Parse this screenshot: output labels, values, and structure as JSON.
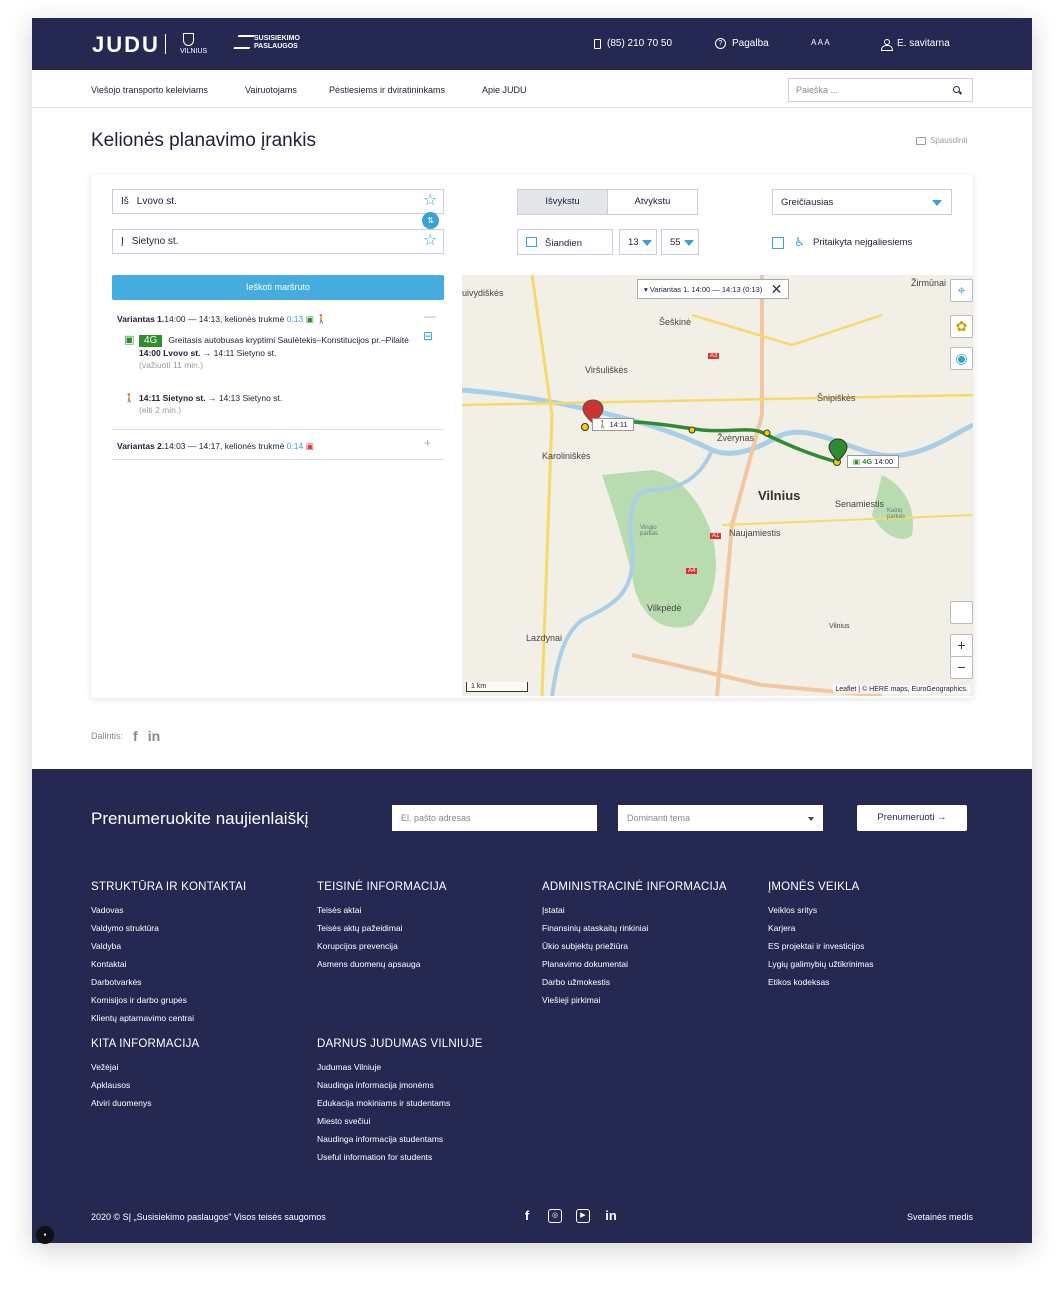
{
  "header": {
    "logo": "JUDU",
    "vilnius_label": "VILNIUS",
    "partner_logo": "SUSISIEKIMO PASLAUGOS",
    "phone": "(85) 210 70 50",
    "help": "Pagalba",
    "font_size": "A A A",
    "account": "E. savitarna"
  },
  "nav": {
    "items": [
      "Viešojo transporto keleiviams",
      "Vairuotojams",
      "Pėstiesiems ir dviratininkams",
      "Apie JUDU"
    ],
    "search_placeholder": "Paieška ..."
  },
  "page": {
    "title": "Kelionės planavimo įrankis",
    "print_label": "Spausdinti"
  },
  "planner": {
    "from_label": "Iš",
    "from_value": "Lvovo st.",
    "to_label": "Į",
    "to_value": "Sietyno st.",
    "depart_tab": "Išvykstu",
    "arrive_tab": "Atvykstu",
    "sort_option": "Greičiausias",
    "date_value": "Šiandien",
    "hour_value": "13",
    "minute_value": "55",
    "accessible_label": "Pritaikyta neįgaliesiems",
    "search_button": "Ieškoti maršruto"
  },
  "results": {
    "variant1": {
      "name": "Variantas 1.",
      "time": "14:00 — 14:13",
      "duration_label": "kelionės trukmė",
      "duration": "0:13",
      "toggle": "—",
      "route_badge": "4G",
      "route_desc": "Greitasis autobusas kryptimi Saulėtekis–Konstitucijos pr.–Pilaitė",
      "bus_leg": "14:00 Lvovo st.",
      "bus_leg_end": "→ 14:11 Sietyno st.",
      "bus_note": "(važiuoti 11 min.)",
      "walk_leg": "14:11 Sietyno st.",
      "walk_leg_end": "→ 14:13 Sietyno st.",
      "walk_note": "(eiti 2 min.)"
    },
    "variant2": {
      "name": "Variantas 2.",
      "time": "14:03 — 14:17",
      "duration_label": "kelionės trukmė",
      "duration": "0:14",
      "toggle": "+"
    }
  },
  "map": {
    "tooltip": "Variantas 1.  14:00 — 14:13 (0:13)",
    "walk_marker": "14:11",
    "bus_marker_route": "4G",
    "bus_marker_time": "14:00",
    "scale": "1 km",
    "attribution": "Leaflet | © HERE maps, EuroGeographics.",
    "zoom_in": "+",
    "zoom_out": "−",
    "labels": {
      "zirmunai": "Žirmūnai",
      "seskine": "Šeškinė",
      "virsuliskes": "Viršuliškės",
      "snipiskes": "Šnipiškės",
      "zverynas": "Žvėrynas",
      "karoliniskes": "Karoliniškės",
      "vilnius": "Vilnius",
      "senamiestis": "Senamiestis",
      "naujamiestis": "Naujamiestis",
      "vilkpede": "Vilkpėdė",
      "lazdynai": "Lazdynai",
      "juosvidiskes": "uivydiškės",
      "vingio": "Vingio parkas",
      "kalnu": "Kalnų parkas",
      "a3": "A3",
      "a1": "A1",
      "a4": "A4",
      "vilnius_station": "Vilnius"
    }
  },
  "share": {
    "label": "Dalintis:"
  },
  "footer": {
    "newsletter_title": "Prenumeruokite naujienlaiškį",
    "email_placeholder": "El. pašto adresas",
    "topic_placeholder": "Dominanti tema",
    "subscribe_button": "Prenumeruoti",
    "columns": [
      {
        "title": "STRUKTŪRA IR KONTAKTAI",
        "links": [
          "Vadovas",
          "Valdymo struktūra",
          "Valdyba",
          "Kontaktai",
          "Darbotvarkės",
          "Komisijos ir darbo grupės",
          "Klientų aptarnavimo centrai"
        ]
      },
      {
        "title": "TEISINĖ INFORMACIJA",
        "links": [
          "Teisės aktai",
          "Teisės aktų pažeidimai",
          "Korupcijos prevencija",
          "Asmens duomenų apsauga"
        ]
      },
      {
        "title": "ADMINISTRACINĖ INFORMACIJA",
        "links": [
          "Įstatai",
          "Finansinių ataskaitų rinkiniai",
          "Ūkio subjektų priežiūra",
          "Planavimo dokumentai",
          "Darbo užmokestis",
          "Viešieji pirkimai"
        ]
      },
      {
        "title": "ĮMONĖS VEIKLA",
        "links": [
          "Veiklos sritys",
          "Karjera",
          "ES projektai ir investicijos",
          "Lygių galimybių užtikrinimas",
          "Etikos kodeksas"
        ]
      },
      {
        "title": "KITA INFORMACIJA",
        "links": [
          "Vežėjai",
          "Apklausos",
          "Atviri duomenys"
        ]
      },
      {
        "title": "DARNUS JUDUMAS VILNIUJE",
        "links": [
          "Judumas Vilniuje",
          "Naudinga informacija įmonėms",
          "Edukacija mokiniams ir studentams",
          "Miesto svečiui",
          "Naudinga informacija studentams",
          "Useful information for students"
        ]
      }
    ],
    "copyright": "2020 © SĮ „Susisiekimo paslaugos\" Visos teisės saugomos",
    "sitemap": "Svetainės medis"
  },
  "colors": {
    "brand_navy": "#252952",
    "accent_blue": "#3aa0d8",
    "route_green": "#2f8f2f"
  }
}
